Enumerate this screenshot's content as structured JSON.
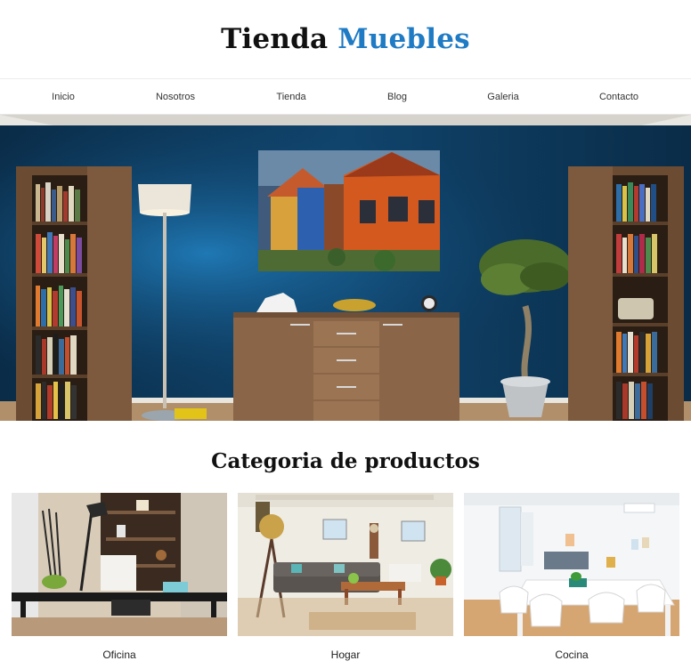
{
  "header": {
    "brand_part1": "Tienda",
    "brand_part2": "Muebles",
    "brand_color": "#1e7bc4"
  },
  "nav": {
    "items": [
      {
        "label": "Inicio"
      },
      {
        "label": "Nosotros"
      },
      {
        "label": "Tienda"
      },
      {
        "label": "Blog"
      },
      {
        "label": "Galeria"
      },
      {
        "label": "Contacto"
      }
    ]
  },
  "hero": {
    "wall_color": "#0f3f66",
    "description_icon": "living-room-photo"
  },
  "categories": {
    "title": "Categoria de productos",
    "items": [
      {
        "label": "Oficina",
        "icon": "office-photo"
      },
      {
        "label": "Hogar",
        "icon": "home-photo"
      },
      {
        "label": "Cocina",
        "icon": "kitchen-photo"
      }
    ]
  }
}
